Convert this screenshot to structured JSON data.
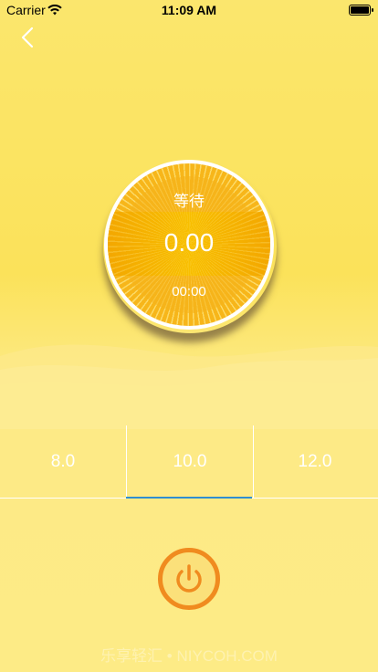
{
  "status_bar": {
    "carrier": "Carrier",
    "time": "11:09 AM"
  },
  "nav": {
    "back_icon": "chevron-left-icon"
  },
  "dial": {
    "status": "等待",
    "value": "0.00",
    "timer": "00:00"
  },
  "picker": {
    "options": [
      "8.0",
      "10.0",
      "12.0"
    ],
    "selected": "10.0"
  },
  "power_button": {
    "icon": "power-icon"
  },
  "watermark": "乐享轻汇 • NIYCOH.COM",
  "colors": {
    "accent": "#f08b1f",
    "dial": "#f6b41a",
    "underline": "#2f8fd0"
  }
}
